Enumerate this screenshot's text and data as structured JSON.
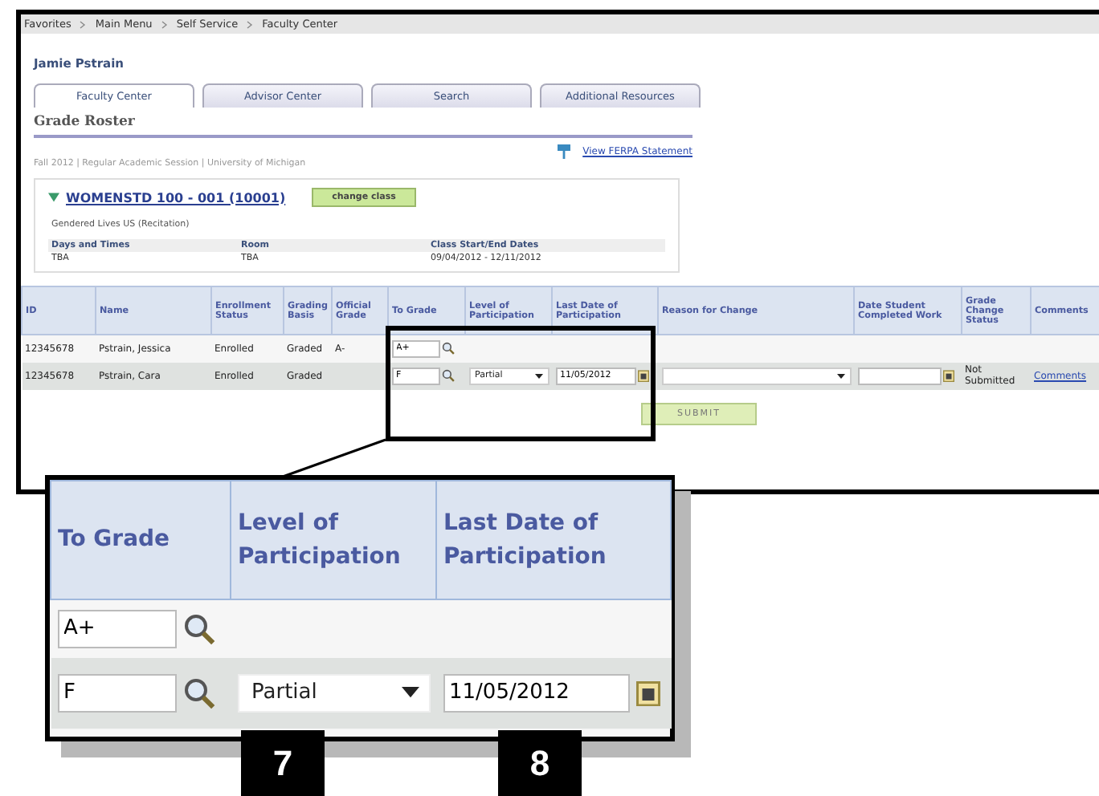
{
  "breadcrumb": [
    "Favorites",
    "Main Menu",
    "Self Service",
    "Faculty Center"
  ],
  "user_name": "Jamie Pstrain",
  "tabs": [
    {
      "label": "Faculty Center",
      "selected": true
    },
    {
      "label": "Advisor Center",
      "selected": false
    },
    {
      "label": "Search",
      "selected": false
    },
    {
      "label": "Additional Resources",
      "selected": false
    }
  ],
  "page_title": "Grade Roster",
  "ferpa_link": "View FERPA Statement",
  "term": "Fall 2012 | Regular Academic Session | University of Michigan",
  "class_section": {
    "title": "WOMENSTD 100 - 001 (10001)",
    "expanded": true,
    "button": "change class",
    "description": "Gendered Lives US (Recitation)",
    "columns": [
      "Days and Times",
      "Room",
      "Class Start/End Dates"
    ],
    "values": [
      "TBA",
      "TBA",
      "09/04/2012 - 12/11/2012"
    ]
  },
  "roster": {
    "columns": [
      "ID",
      "Name",
      "Enrollment Status",
      "Grading Basis",
      "Official Grade",
      "To Grade",
      "Level of Participation",
      "Last Date of Participation",
      "Reason for Change",
      "Date Student Completed Work",
      "Grade Change Status",
      "Comments"
    ],
    "rows": [
      {
        "id": "12345678",
        "name": "Pstrain, Jessica",
        "enrollment": "Enrolled",
        "basis": "Graded",
        "official_grade": "A-",
        "to_grade": "A+"
      },
      {
        "id": "12345678",
        "name": "Pstrain, Cara",
        "enrollment": "Enrolled",
        "basis": "Graded",
        "to_grade": "F",
        "level": "Partial",
        "last_date": "11/05/2012",
        "reason": "",
        "date_completed": "",
        "status": "Not Submitted",
        "comments": "Comments"
      }
    ]
  },
  "submit_button": "SUBMIT",
  "callout": {
    "columns": [
      "To Grade",
      "Level of Participation",
      "Last Date of Participation"
    ],
    "rows": [
      {
        "to_grade": "A+"
      },
      {
        "to_grade": "F",
        "level": "Partial",
        "last_date": "11/05/2012"
      }
    ]
  },
  "step_markers": [
    "7",
    "8"
  ]
}
